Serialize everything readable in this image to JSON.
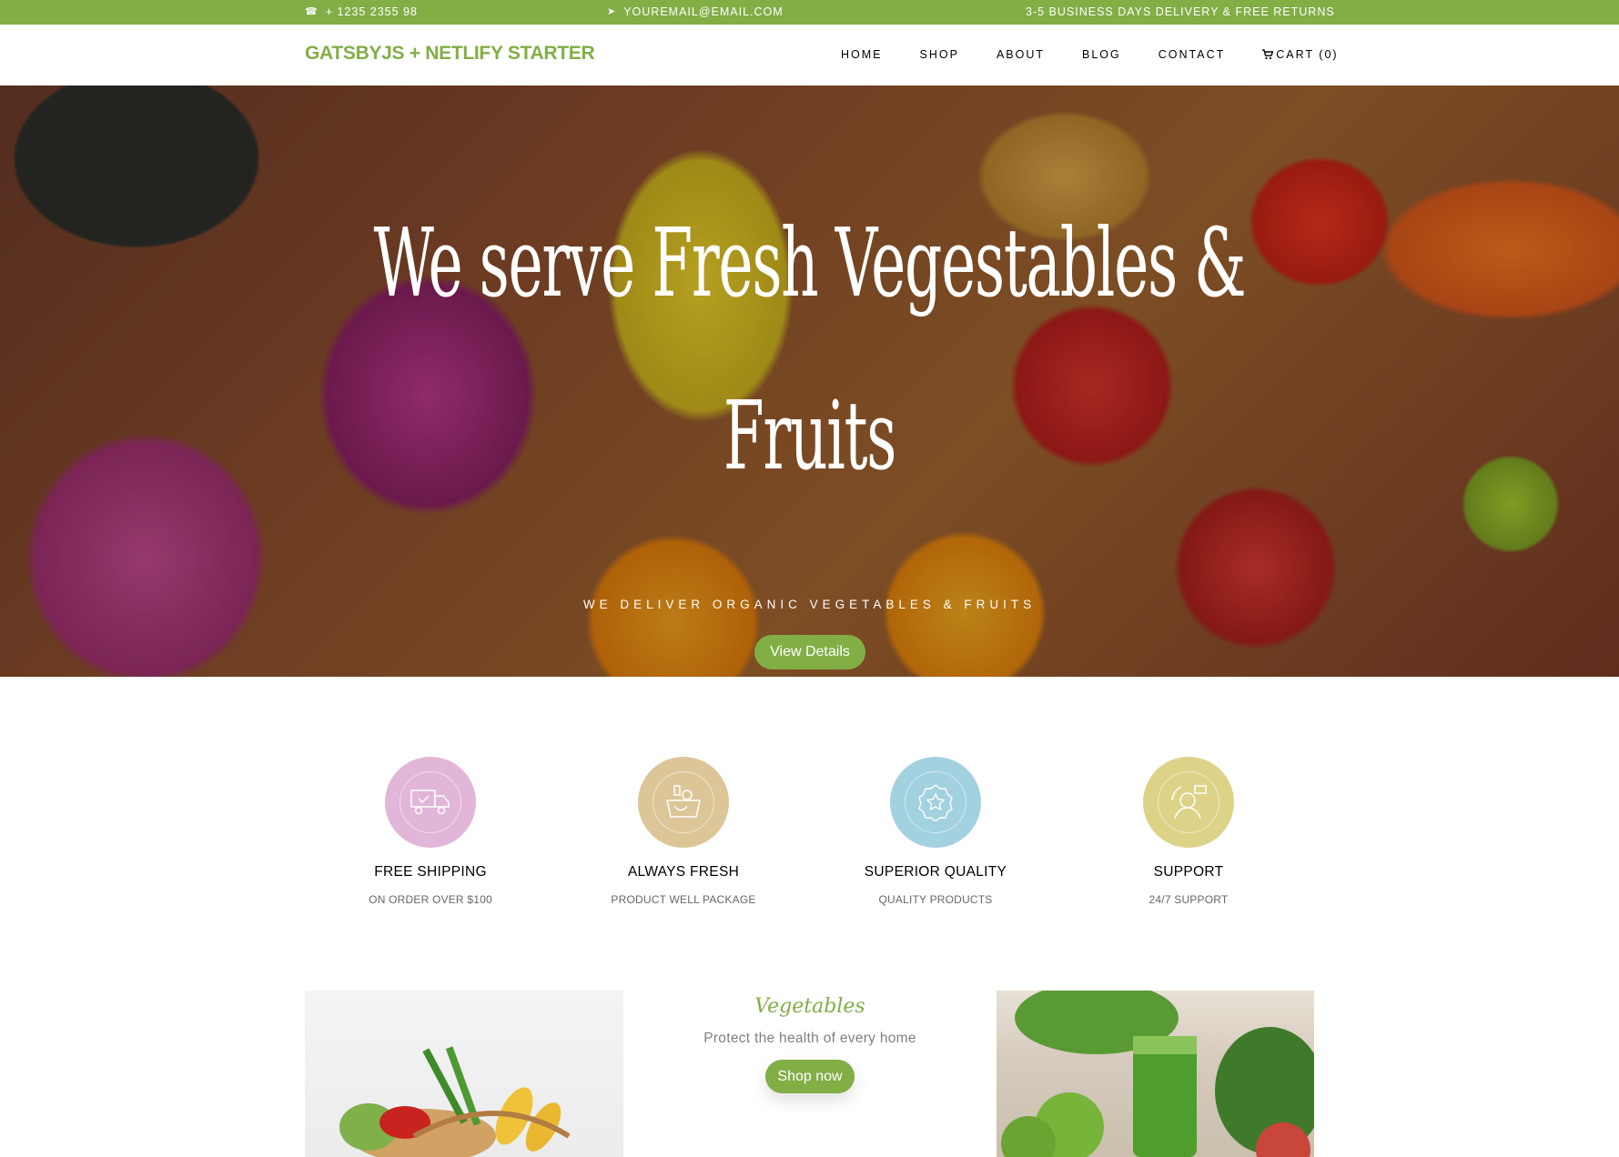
{
  "topbar": {
    "phone": "+ 1235 2355 98",
    "email": "YOUREMAIL@EMAIL.COM",
    "delivery": "3-5 BUSINESS DAYS DELIVERY & FREE RETURNS"
  },
  "brand": "GATSBYJS + NETLIFY STARTER",
  "nav": {
    "home": "HOME",
    "shop": "SHOP",
    "about": "ABOUT",
    "blog": "BLOG",
    "contact": "CONTACT",
    "cart": "CART (0)"
  },
  "hero": {
    "title_line1": "We serve Fresh Vegestables &",
    "title_line2": "Fruits",
    "subtitle": "WE DELIVER ORGANIC VEGETABLES & FRUITS",
    "button": "View Details"
  },
  "services": [
    {
      "title": "FREE SHIPPING",
      "desc": "ON ORDER OVER $100",
      "color": "#e2b6d8",
      "icon": "delivery-truck-icon"
    },
    {
      "title": "ALWAYS FRESH",
      "desc": "PRODUCT WELL PACKAGE",
      "color": "#dcc698",
      "icon": "grocery-basket-icon"
    },
    {
      "title": "SUPERIOR QUALITY",
      "desc": "QUALITY PRODUCTS",
      "color": "#a2d1e0",
      "icon": "award-badge-icon"
    },
    {
      "title": "SUPPORT",
      "desc": "24/7 SUPPORT",
      "color": "#dcd388",
      "icon": "support-agent-icon"
    }
  ],
  "category": {
    "title": "Vegetables",
    "desc": "Protect the health of every home",
    "button": "Shop now"
  },
  "accent": "#82ae46"
}
